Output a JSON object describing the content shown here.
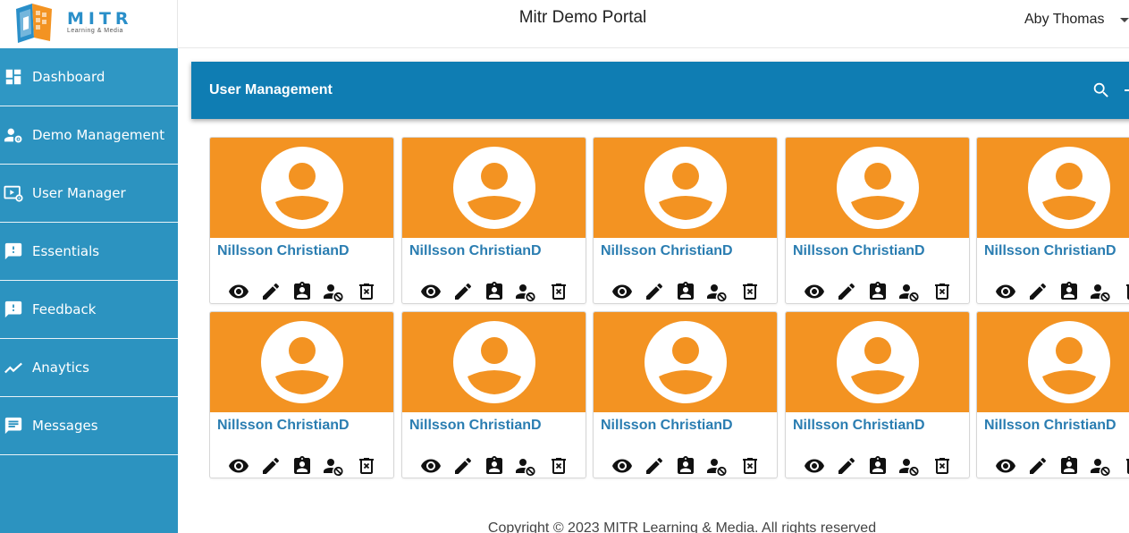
{
  "logo": {
    "wordmark": "MITR",
    "tagline": "Learning & Media"
  },
  "header": {
    "title": "Mitr Demo Portal",
    "user_name": "Aby Thomas"
  },
  "sidebar": {
    "items": [
      {
        "label": "Dashboard",
        "icon": "dashboard-icon"
      },
      {
        "label": "Demo Management",
        "icon": "user-settings-icon"
      },
      {
        "label": "User Manager",
        "icon": "screen-settings-icon"
      },
      {
        "label": "Essentials",
        "icon": "feedback-icon"
      },
      {
        "label": "Feedback",
        "icon": "feedback-icon"
      },
      {
        "label": "Anaytics",
        "icon": "analytics-icon"
      },
      {
        "label": "Messages",
        "icon": "message-icon"
      }
    ]
  },
  "banner": {
    "title": "User Management"
  },
  "cards": [
    {
      "name": "Nillsson ChristianD"
    },
    {
      "name": "Nillsson ChristianD"
    },
    {
      "name": "Nillsson ChristianD"
    },
    {
      "name": "Nillsson ChristianD"
    },
    {
      "name": "Nillsson ChristianD"
    },
    {
      "name": "Nillsson ChristianD"
    },
    {
      "name": "Nillsson ChristianD"
    },
    {
      "name": "Nillsson ChristianD"
    },
    {
      "name": "Nillsson ChristianD"
    },
    {
      "name": "Nillsson ChristianD"
    }
  ],
  "card_actions": [
    "view-icon",
    "edit-icon",
    "assignment-icon",
    "block-user-icon",
    "delete-icon"
  ],
  "footer": {
    "text": "Copyright © 2023 MITR Learning & Media. All rights reserved"
  },
  "colors": {
    "sidebar": "#2c93c0",
    "banner": "#0f7db3",
    "card_media": "#f39322",
    "name_text": "#2a7db1"
  }
}
